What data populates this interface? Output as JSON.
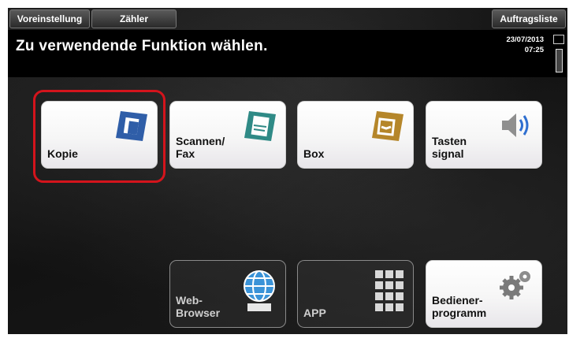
{
  "topbar": {
    "preset_label": "Voreinstellung",
    "counter_label": "Zähler",
    "jobs_label": "Auftragsliste"
  },
  "header": {
    "title": "Zu verwendende Funktion wählen.",
    "date": "23/07/2013",
    "time": "07:25"
  },
  "tiles": [
    {
      "label": "Kopie",
      "icon": "copy-icon",
      "selected": true,
      "enabled": true
    },
    {
      "label": "Scannen/\nFax",
      "icon": "scan-fax-icon",
      "enabled": true
    },
    {
      "label": "Box",
      "icon": "box-icon",
      "enabled": true
    },
    {
      "label": "Tasten\nsignal",
      "icon": "speaker-icon",
      "enabled": true
    },
    {
      "label": "Web-\nBrowser",
      "icon": "globe-icon",
      "enabled": false
    },
    {
      "label": "APP",
      "icon": "app-grid-icon",
      "enabled": false
    },
    {
      "label": "Bediener-\nprogramm",
      "icon": "gears-icon",
      "enabled": true
    }
  ],
  "colors": {
    "selection_ring": "#d4141c",
    "icon_copy": "#2f5ea8",
    "icon_scan": "#2f8a86",
    "icon_box": "#b5862a"
  }
}
